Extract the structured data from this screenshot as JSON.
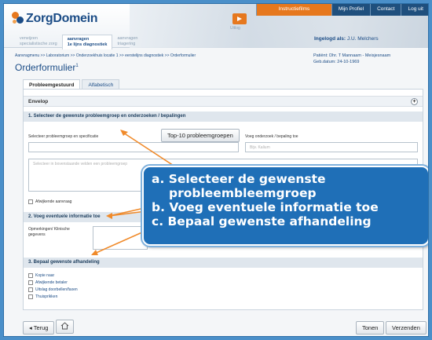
{
  "header": {
    "logo": "ZorgDomein",
    "top_nav": [
      "Instructiefilms",
      "Mijn Profiel",
      "Contact",
      "Log uit"
    ],
    "tabs": [
      {
        "line1": "verwijzen",
        "line2": "specialistische zorg"
      },
      {
        "line1": "aanvragen",
        "line2": "1e lijns diagnostiek"
      },
      {
        "line1": "aanvragen",
        "line2": "triagering"
      }
    ],
    "uitlog_label": "Uitlog",
    "login_label": "Ingelogd als:",
    "login_user": "J.U. Melchers"
  },
  "breadcrumb": "Aanvragmenu >> Laboratorium >> Onderzoekhuis locatie 1 >> eerstelijns diagnostiek >> Orderformulier",
  "page_title": "Orderformulier",
  "page_title_sup": "1",
  "patient": {
    "line1": "Patiënt: Dhr. T Mannaam - Meisjesnaam",
    "line2": "Geb.datum: 24-10-1969"
  },
  "form_tabs": [
    "Probleemgestuurd",
    "Alfabetisch"
  ],
  "envelop": "Envelop",
  "section1": {
    "title": "1. Selecteer de gewenste probleemgroep en onderzoeken / bepalingen",
    "select_label": "Selecteer probleemgroep en specificatie",
    "top10_button": "Top-10 probleemgroepen",
    "add_label": "Voeg onderzoek / bepaling toe",
    "add_placeholder": "Bijv. Kalium",
    "results_placeholder": "Selecteer in bovenstaande velden een probleemgroep",
    "deviating_request": "Afwijkende aanvraag"
  },
  "section2": {
    "title": "2. Voeg eventuele informatie toe",
    "notes_label_1": "Opmerkingen/ Klinische",
    "notes_label_2": "gegevens"
  },
  "section3": {
    "title": "3. Bepaal gewenste afhandeling",
    "options": [
      "Kopie naar",
      "Afwijkende betaler",
      "Uitslag doorbellen/faxen",
      "Thuisprikken"
    ]
  },
  "footer": {
    "back": "◂ Terug",
    "show": "Tonen",
    "send": "Verzenden"
  },
  "callout": {
    "a": "a. Selecteer de  gewenste",
    "a2": "probleembleemgroep",
    "b": "b. Voeg eventuele informatie toe",
    "c": "c. Bepaal gewenste afhandeling"
  },
  "colors": {
    "accent": "#e6781e",
    "brand": "#1b4c86",
    "callout": "#1f6fb7"
  }
}
